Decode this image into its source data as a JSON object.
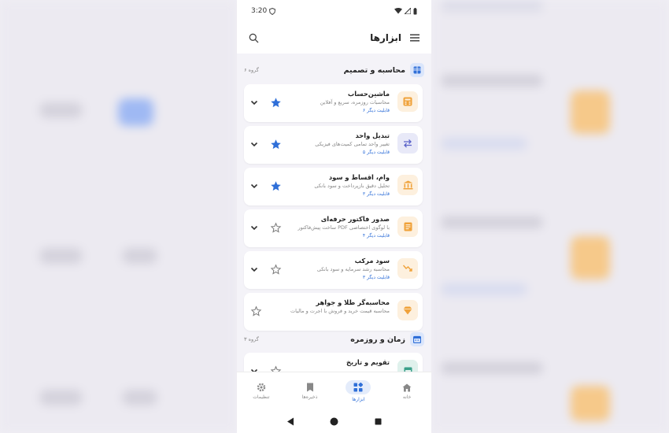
{
  "status_bar": {
    "time": "3:20"
  },
  "app_bar": {
    "title": "ابزارها"
  },
  "sections": [
    {
      "name": "محاسبه و تصمیم",
      "count": "۶ گروه",
      "icon": "grid-icon",
      "color": "#2f6fd8"
    },
    {
      "name": "زمان و روزمره",
      "count": "۳ گروه",
      "icon": "calendar-icon",
      "color": "#2f6fd8"
    }
  ],
  "tools": [
    {
      "title": "ماشین‌حساب",
      "desc": "محاسبات روزمره، سریع و آفلاین",
      "more": "۶ قابلیت دیگر",
      "starred": true,
      "icon": "calculator-icon",
      "color": "#f0a23a",
      "bg": "#fdf0de"
    },
    {
      "title": "تبدیل واحد",
      "desc": "تغییر واحد تمامی کمیت‌های فیزیکی",
      "more": "۵ قابلیت دیگر",
      "starred": true,
      "icon": "swap-icon",
      "color": "#5b63c9",
      "bg": "#e8e9f8"
    },
    {
      "title": "وام، اقساط و سود",
      "desc": "تحلیل دقیق بازپرداخت و سود بانکی",
      "more": "۳ قابلیت دیگر",
      "starred": true,
      "icon": "bank-icon",
      "color": "#f0a23a",
      "bg": "#fdf0de"
    },
    {
      "title": "صدور فاکتور حرفه‌ای",
      "desc": "ساخت پیش‌فاکتور PDF با لوگوی اختصاصی",
      "more": "۴ قابلیت دیگر",
      "starred": false,
      "icon": "invoice-icon",
      "color": "#f0a23a",
      "bg": "#fdf0de"
    },
    {
      "title": "سود مرکب",
      "desc": "محاسبه رشد سرمایه و سود بانکی",
      "more": "۳ قابلیت دیگر",
      "starred": false,
      "icon": "trend-icon",
      "color": "#f0a23a",
      "bg": "#fdf0de"
    },
    {
      "title": "محاسبه‌گر طلا و جواهر",
      "desc": "محاسبه قیمت خرید و فروش با اجرت و مالیات",
      "more": "",
      "starred": false,
      "icon": "diamond-icon",
      "color": "#f0a23a",
      "bg": "#fdf0de"
    },
    {
      "title": "تقویم و تاریخ",
      "desc": "",
      "more": "",
      "starred": false,
      "icon": "calendar-icon",
      "color": "#3aa08a",
      "bg": "#dff1ec"
    }
  ],
  "bottom_nav": [
    {
      "label": "تنظیمات",
      "icon": "gear-icon",
      "active": false
    },
    {
      "label": "ذخیره‌ها",
      "icon": "bookmark-icon",
      "active": false
    },
    {
      "label": "ابزارها",
      "icon": "widgets-icon",
      "active": true
    },
    {
      "label": "خانه",
      "icon": "home-icon",
      "active": false
    }
  ],
  "colors": {
    "accent": "#2f6fd8",
    "star_on": "#2f6fd8",
    "star_off": "#777777"
  }
}
